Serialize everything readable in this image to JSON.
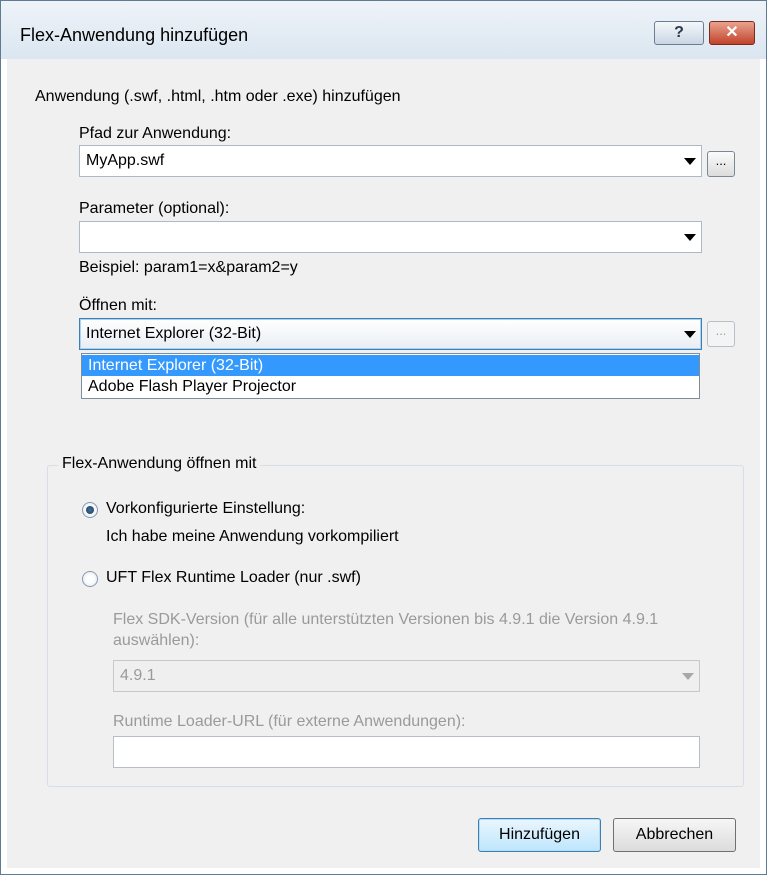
{
  "window": {
    "title": "Flex-Anwendung hinzufügen",
    "help_button": "?",
    "close_button": "✕"
  },
  "section_heading": "Anwendung (.swf, .html, .htm oder .exe) hinzufügen",
  "path": {
    "label": "Pfad zur Anwendung:",
    "value": "MyApp.swf",
    "browse": "..."
  },
  "params": {
    "label": "Parameter (optional):",
    "value": "",
    "example": "Beispiel: param1=x&param2=y"
  },
  "open_with": {
    "label": "Öffnen mit:",
    "value": "Internet Explorer (32-Bit)",
    "browse": "...",
    "options": [
      "Internet Explorer (32-Bit)",
      "Adobe Flash Player Projector"
    ]
  },
  "flex_group": {
    "legend": "Flex-Anwendung öffnen mit",
    "radio_preconfigured": "Vorkonfigurierte Einstellung:",
    "preconfigured_desc": "Ich habe meine Anwendung vorkompiliert",
    "radio_runtime_loader": "UFT Flex Runtime Loader (nur .swf)",
    "sdk_label_line1": "Flex SDK-Version (für alle unterstützten Versionen bis 4.9.1 die Version 4.9.1",
    "sdk_label_line2": "auswählen):",
    "sdk_value": "4.9.1",
    "loader_url_label": "Runtime Loader-URL (für externe Anwendungen):",
    "loader_url_value": ""
  },
  "buttons": {
    "add": "Hinzufügen",
    "cancel": "Abbrechen"
  }
}
